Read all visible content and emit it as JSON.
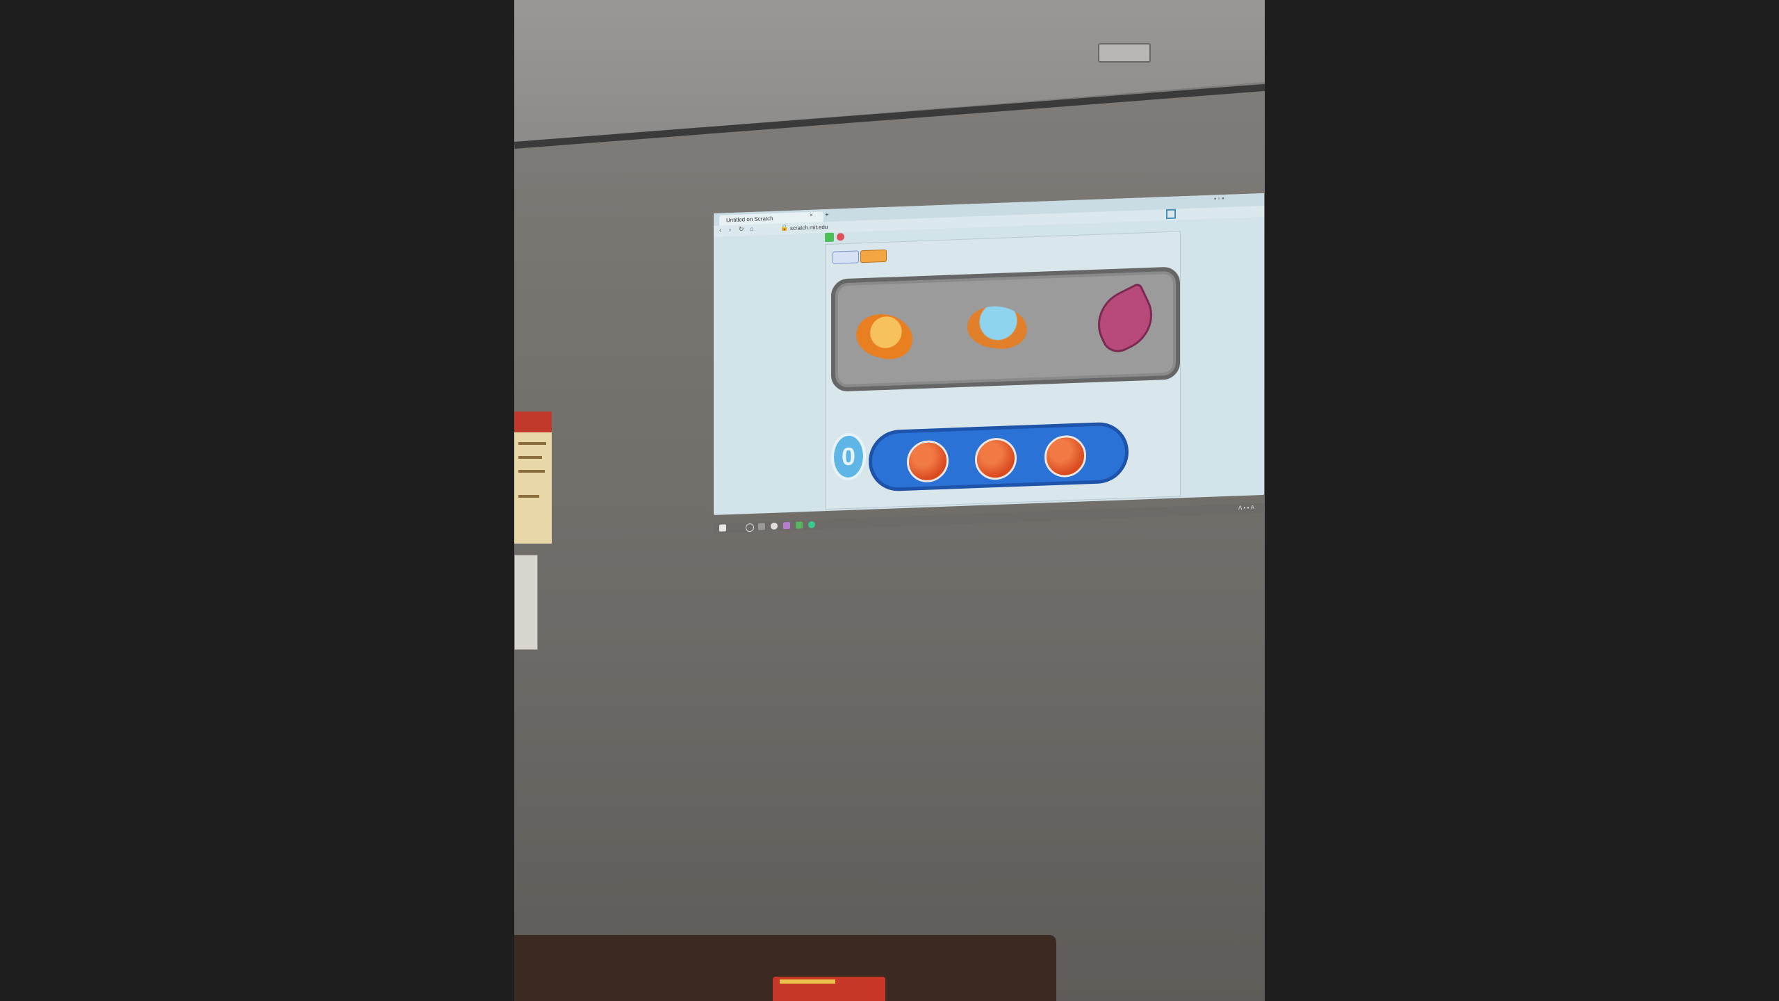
{
  "browser": {
    "tab_title": "Untitled on Scratch",
    "tab_close": "×",
    "tab_new": "+",
    "url": "scratch.mit.edu"
  },
  "stage": {
    "counter_value": "0",
    "ball_count": 3
  },
  "colors": {
    "stage_bg": "#d9e7ed",
    "tray": "#9b9b9b",
    "track": "#2a72d6",
    "ball": "#d94a1f",
    "counter": "#5fb5e6"
  },
  "icons": {
    "back": "back-arrow-icon",
    "forward": "forward-arrow-icon",
    "reload": "reload-icon",
    "home": "home-icon",
    "lock": "lock-icon",
    "fullscreen": "fullscreen-icon",
    "green_flag": "green-flag-icon",
    "stop": "stop-icon",
    "windows_start": "windows-start-icon"
  }
}
